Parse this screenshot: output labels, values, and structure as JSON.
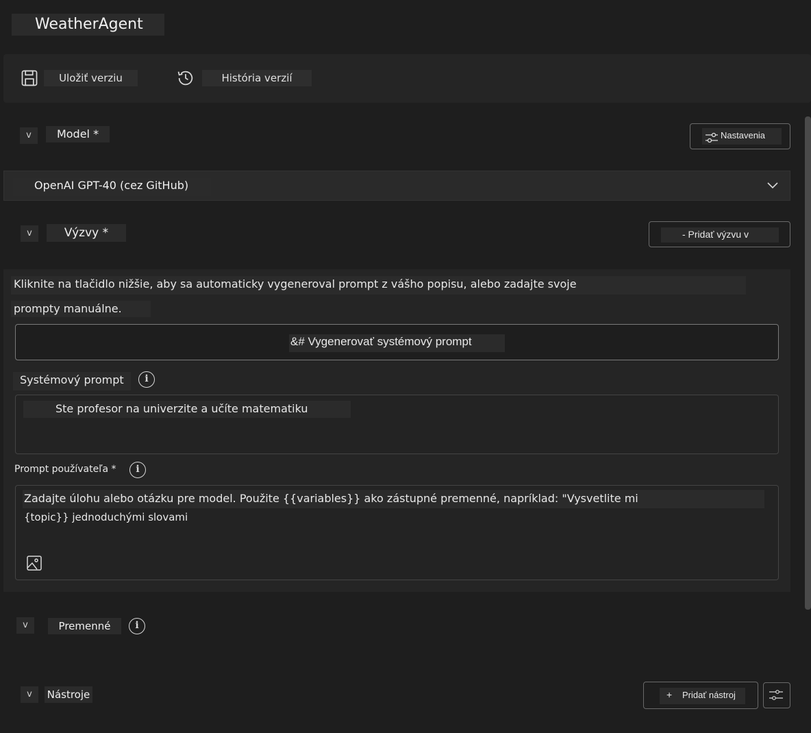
{
  "app": {
    "title": "WeatherAgent"
  },
  "toolbar": {
    "save_label": "Uložiť verziu",
    "history_label": "História verzií"
  },
  "model_section": {
    "toggle": "v",
    "label": "Model *",
    "settings_label": "Nastavenia",
    "selected_model": "OpenAI GPT-40 (cez GitHub)"
  },
  "prompts_section": {
    "toggle": "v",
    "label": "Výzvy *",
    "add_prompt_label": "- Pridať výzvu v",
    "description_line1": "Kliknite na tlačidlo nižšie, aby sa automaticky vygeneroval prompt z vášho popisu, alebo zadajte svoje",
    "description_line2": "prompty manuálne.",
    "generate_label": "&# Vygenerovať systémový prompt",
    "system_prompt_label": "Systémový prompt",
    "system_prompt_value": "Ste profesor na univerzite a učíte matematiku",
    "user_prompt_label": "Prompt používateľa *",
    "user_prompt_line1": "Zadajte úlohu alebo otázku pre model. Použite {{variables}} ako zástupné premenné, napríklad: \"Vysvetlite mi",
    "user_prompt_line2": "{topic}} jednoduchými slovami"
  },
  "variables_section": {
    "toggle": "v",
    "label": "Premenné"
  },
  "tools_section": {
    "toggle": "v",
    "label": "Nástroje",
    "add_tool_label": "Pridať nástroj",
    "add_tool_icon": "+"
  },
  "icons": {
    "save": "save-icon",
    "history": "history-icon",
    "settings": "settings-sliders-icon",
    "chevron": "chevron-down-icon",
    "info": "info-icon",
    "image": "image-icon",
    "tool_settings": "tool-settings-icon"
  }
}
